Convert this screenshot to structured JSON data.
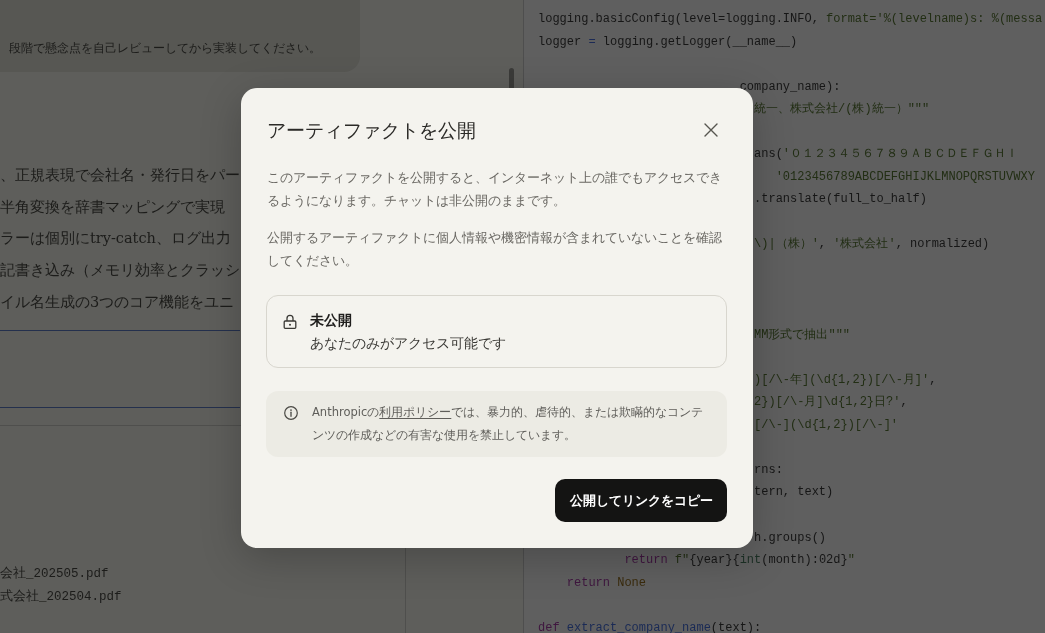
{
  "chat": {
    "user_message": "段階で懸念点を自己レビューしてから実装してください。",
    "response_lines": [
      "、正規表現で会社名・発行日をパー",
      "半角変換を辞書マッピングで実現",
      "ラーは個別にtry-catch、ログ出力",
      "記書き込み（メモリ効率とクラッシ",
      "イル名生成の3つのコア機能をユニ"
    ],
    "code_block_lines": [
      "会社_202505.pdf",
      "式会社_202504.pdf"
    ]
  },
  "code_panel": {
    "lines": [
      {
        "kind": "full",
        "tokens": [
          {
            "kind": "plain",
            "text": "logging.basicConfig(level=logging.INFO, "
          },
          {
            "kind": "string",
            "text": "format='%(levelname)s: %(messa"
          }
        ]
      },
      {
        "kind": "full",
        "tokens": [
          {
            "kind": "plain",
            "text": "logger "
          },
          {
            "kind": "operator",
            "text": "="
          },
          {
            "kind": "plain",
            "text": " logging.getLogger(__name__)"
          }
        ]
      },
      {
        "kind": "blank"
      },
      {
        "kind": "partial",
        "tokens": [
          {
            "kind": "plain",
            "text": "company_name):"
          }
        ]
      },
      {
        "kind": "partial",
        "tokens": [
          {
            "kind": "string",
            "text": "統一、株式会社/(株)統一）\"\"\""
          }
        ]
      },
      {
        "kind": "blank"
      },
      {
        "kind": "partial",
        "tokens": [
          {
            "kind": "plain",
            "text": "ans("
          },
          {
            "kind": "string",
            "text": "'０１２３４５６７８９ＡＢＣＤＥＦＧＨＩ"
          }
        ]
      },
      {
        "kind": "partial",
        "tokens": [
          {
            "kind": "string",
            "text": "   '0123456789ABCDEFGHIJKLMNOPQRSTUVWXY"
          }
        ]
      },
      {
        "kind": "partial",
        "tokens": [
          {
            "kind": "plain",
            "text": ".translate(full_to_half)"
          }
        ]
      },
      {
        "kind": "blank"
      },
      {
        "kind": "partial",
        "tokens": [
          {
            "kind": "string",
            "text": "\\)|（株）'"
          },
          {
            "kind": "plain",
            "text": ", "
          },
          {
            "kind": "string",
            "text": "'株式会社'"
          },
          {
            "kind": "plain",
            "text": ", normalized)"
          }
        ]
      },
      {
        "kind": "blank"
      },
      {
        "kind": "blank"
      },
      {
        "kind": "blank"
      },
      {
        "kind": "partial",
        "tokens": [
          {
            "kind": "string",
            "text": "MM形式で抽出\"\"\""
          }
        ]
      },
      {
        "kind": "blank"
      },
      {
        "kind": "partial",
        "tokens": [
          {
            "kind": "string",
            "text": ")[/\\-年](\\d{1,2})[/\\-月]'"
          },
          {
            "kind": "plain",
            "text": ","
          }
        ]
      },
      {
        "kind": "partial",
        "tokens": [
          {
            "kind": "string",
            "text": "2})[/\\-月]\\d{1,2}日?'"
          },
          {
            "kind": "plain",
            "text": ","
          }
        ]
      },
      {
        "kind": "partial",
        "tokens": [
          {
            "kind": "string",
            "text": "[/\\-](\\d{1,2})[/\\-]'"
          }
        ]
      },
      {
        "kind": "blank"
      },
      {
        "kind": "partial",
        "tokens": [
          {
            "kind": "plain",
            "text": "rns:"
          }
        ]
      },
      {
        "kind": "partial",
        "tokens": [
          {
            "kind": "plain",
            "text": "tern, text)"
          }
        ]
      },
      {
        "kind": "blank"
      },
      {
        "kind": "partial",
        "tokens": [
          {
            "kind": "plain",
            "text": "h.groups()"
          }
        ]
      },
      {
        "kind": "full",
        "tokens": [
          {
            "kind": "keyword",
            "text": "            return"
          },
          {
            "kind": "string",
            "text": " f\""
          },
          {
            "kind": "plain",
            "text": "{year}{"
          },
          {
            "kind": "builtin",
            "text": "int"
          },
          {
            "kind": "plain",
            "text": "(month):02d}"
          },
          {
            "kind": "string",
            "text": "\""
          }
        ]
      },
      {
        "kind": "full",
        "tokens": [
          {
            "kind": "keyword",
            "text": "    return"
          },
          {
            "kind": "constant",
            "text": " None"
          }
        ]
      },
      {
        "kind": "blank"
      },
      {
        "kind": "full",
        "tokens": [
          {
            "kind": "keyword",
            "text": "def"
          },
          {
            "kind": "function",
            "text": " extract_company_name"
          },
          {
            "kind": "plain",
            "text": "(text):"
          }
        ]
      }
    ]
  },
  "dialog": {
    "title": "アーティファクトを公開",
    "paragraphs": [
      "このアーティファクトを公開すると、インターネット上の誰でもアクセスできるようになります。チャットは非公開のままです。",
      "公開するアーティファクトに個人情報や機密情報が含まれていないことを確認してください。"
    ],
    "visibility": {
      "title": "未公開",
      "description": "あなたのみがアクセス可能です"
    },
    "notice": {
      "before": "Anthropicの",
      "link": "利用ポリシー",
      "after": "では、暴力的、虐待的、または欺瞞的なコンテンツの作成などの有害な使用を禁止しています。"
    },
    "primary_button": "公開してリンクをコピー"
  }
}
